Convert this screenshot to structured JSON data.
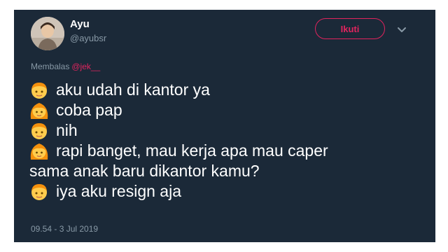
{
  "tweet": {
    "author_name": "Ayu",
    "author_handle": "@ayubsr",
    "follow_label": "Ikuti",
    "reply_prefix": "Membalas",
    "reply_mention": "@jek__",
    "lines": [
      {
        "emoji": "boy-face-icon",
        "text": "aku udah di kantor ya"
      },
      {
        "emoji": "girl-face-icon",
        "text": "coba pap"
      },
      {
        "emoji": "boy-face-icon",
        "text": "nih"
      },
      {
        "emoji": "girl-face-icon",
        "text": "rapi banget, mau kerja apa mau caper"
      },
      {
        "emoji": "",
        "text": "sama anak baru dikantor kamu?"
      },
      {
        "emoji": "boy-face-icon",
        "text": "iya aku resign aja"
      }
    ],
    "timestamp": "09.54 - 3 Jul 2019"
  },
  "colors": {
    "card_bg": "#1b2938",
    "accent": "#e0245e",
    "muted": "#8899a6",
    "text": "#ffffff"
  }
}
